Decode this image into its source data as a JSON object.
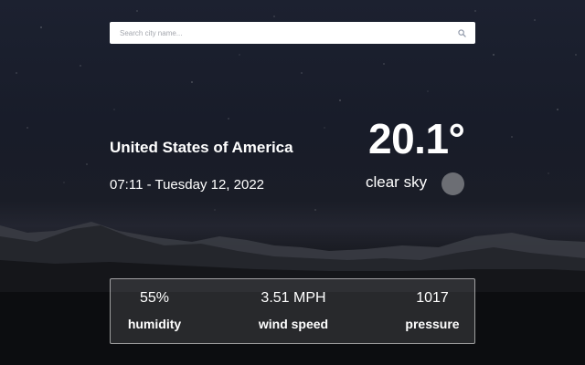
{
  "search": {
    "placeholder": "Search city name...",
    "value": "",
    "icon": "search-icon"
  },
  "location": {
    "city": "United States of America",
    "datetime": "07:11 - Tuesday 12, 2022"
  },
  "weather": {
    "temperature": "20.1°",
    "condition": "clear sky",
    "condition_icon": "clear-sky-icon"
  },
  "stats": {
    "humidity": {
      "value": "55%",
      "label": "humidity"
    },
    "wind": {
      "value": "3.51 MPH",
      "label": "wind speed"
    },
    "pressure": {
      "value": "1017",
      "label": "pressure"
    }
  },
  "colors": {
    "text": "#ffffff",
    "search_background": "#ffffff",
    "placeholder": "#a3a6ad",
    "condition_icon": "#6c6e74",
    "sky": "#1c2130"
  }
}
